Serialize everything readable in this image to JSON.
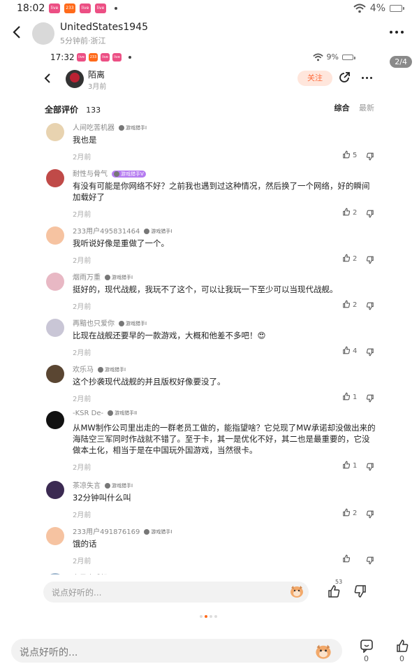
{
  "status_bar": {
    "time": "18:02",
    "battery": "4%",
    "apps": [
      "app1",
      "233",
      "app2",
      "app3"
    ]
  },
  "header": {
    "username": "UnitedStates1945",
    "subtitle": "5分钟前·浙江"
  },
  "page_indicator": "2/4",
  "inner": {
    "status_bar": {
      "time": "17:32",
      "battery": "9%"
    },
    "header": {
      "name": "陌离",
      "time": "3月前",
      "follow_label": "关注"
    },
    "sort": {
      "title": "全部评价",
      "count": "133",
      "tab_active": "综合",
      "tab_other": "最新"
    },
    "comments": [
      {
        "name": "人间吃苦机器",
        "badge": "游戏猎手I",
        "text": "我也是",
        "date": "2月前",
        "likes": "5",
        "avatar_color": "#e8d3b0"
      },
      {
        "name": "耐性与骨气",
        "badge": "游戏猎手V",
        "text": "有没有可能是你网络不好？之前我也遇到过这种情况，然后换了一个网络，好的瞬间加载好了",
        "date": "2月前",
        "likes": "2",
        "avatar_color": "#c04a48"
      },
      {
        "name": "233用户495831464",
        "badge": "游戏猎手I",
        "text": "我听说好像是重做了一个。",
        "date": "2月前",
        "likes": "2",
        "avatar_color": "#f6c3a1"
      },
      {
        "name": "烟雨万重",
        "badge": "游戏猎手I",
        "text": "挺好的，现代战舰，我玩不了这个，可以让我玩一下至少可以当现代战舰。",
        "date": "2月前",
        "likes": "2",
        "avatar_color": "#e8b8c4"
      },
      {
        "name": "再黯也只爱你",
        "badge": "游戏猎手I",
        "text": "比现在战舰还要早的一款游戏，大概和他差不多吧！😍",
        "date": "2月前",
        "likes": "4",
        "avatar_color": "#c9c6d6"
      },
      {
        "name": "欢乐马",
        "badge": "游戏猎手I",
        "text": "这个抄袭现代战舰的并且版权好像要没了。",
        "date": "2月前",
        "likes": "1",
        "avatar_color": "#5a4632"
      },
      {
        "name": "-KSR De-",
        "badge": "游戏猎手II",
        "text": "从MW制作公司里出走的一群老员工做的，能指望啥？它兑现了MW承诺却没做出来的海陆空三军同时作战就不错了。至于卡，其一是优化不好，其二也是最重要的，它没做本土化，相当于是在中国玩外国游戏，当然很卡。",
        "date": "2月前",
        "likes": "1",
        "avatar_color": "#111111"
      },
      {
        "name": "茶凉失言",
        "badge": "游戏猎手I",
        "text": "32分钟叫什么叫",
        "date": "2月前",
        "likes": "2",
        "avatar_color": "#3b2a52"
      },
      {
        "name": "233用户491876169",
        "badge": "游戏猎手I",
        "text": "饿的话",
        "date": "2月前",
        "likes": "",
        "avatar_color": "#f6c3a1"
      },
      {
        "name": "东风吹千怨",
        "badge": "游戏猎手I",
        "text": "",
        "date": "",
        "likes": "",
        "avatar_color": "#9bb4cc"
      }
    ],
    "bottom": {
      "placeholder": "说点好听的...",
      "like_count": "53"
    }
  },
  "bottom_bar": {
    "placeholder": "说点好听的...",
    "comment_count": "0",
    "like_count": "0"
  },
  "colors": {
    "accent": "#ff6a1a",
    "follow_bg": "#ffe6dc",
    "badge_pink": "#ec4f84"
  }
}
